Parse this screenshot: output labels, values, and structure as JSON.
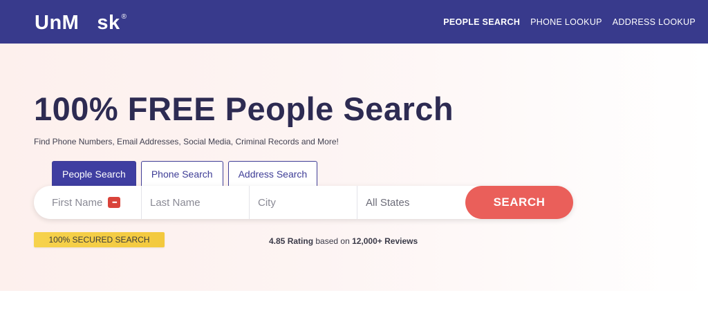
{
  "header": {
    "logo_left": "UnM",
    "logo_right": "sk",
    "logo_mark": "®",
    "nav": [
      {
        "label": "PEOPLE SEARCH",
        "active": true
      },
      {
        "label": "PHONE LOOKUP",
        "active": false
      },
      {
        "label": "ADDRESS LOOKUP",
        "active": false
      }
    ]
  },
  "hero": {
    "title": "100% FREE People Search",
    "subtitle": "Find Phone Numbers, Email Addresses, Social Media, Criminal Records and More!",
    "tabs": [
      {
        "label": "People Search",
        "active": true
      },
      {
        "label": "Phone Search",
        "active": false
      },
      {
        "label": "Address Search",
        "active": false
      }
    ],
    "search": {
      "first_name_placeholder": "First Name",
      "last_name_placeholder": "Last Name",
      "city_placeholder": "City",
      "state_selected": "All States",
      "button_label": "SEARCH"
    },
    "secured_badge": "100% SECURED SEARCH",
    "rating": {
      "value": "4.85 Rating",
      "middle": " based on ",
      "reviews": "12,000+ Reviews"
    }
  },
  "colors": {
    "header_bg": "#383a8c",
    "title": "#2d2b52",
    "tab_active": "#3f3ea1",
    "search_button": "#ea5f5a",
    "badge": "#f3c93e"
  }
}
